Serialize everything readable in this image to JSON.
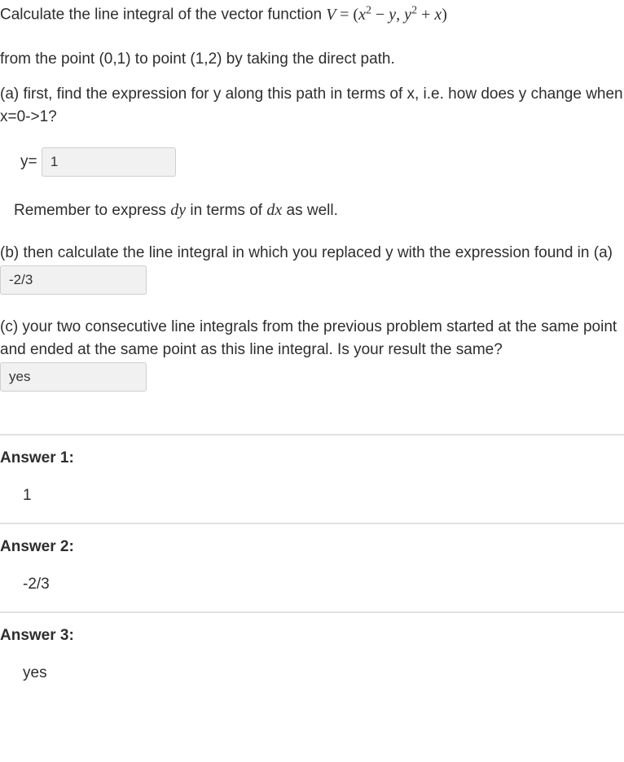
{
  "intro": {
    "line1_pre": "Calculate the line integral of the vector function ",
    "formula": "V = (x² − y, y² + x)",
    "line2": "from the point (0,1) to point (1,2) by taking the direct path."
  },
  "partA": {
    "text": "(a) first, find the expression  for y along this path in terms of x, i.e. how does y change when x=0->1?",
    "ylabel": "y=",
    "value": "1",
    "remember_pre": "Remember to express ",
    "dy": "dy",
    "remember_mid": " in terms of ",
    "dx": "dx",
    "remember_post": " as well."
  },
  "partB": {
    "text_pre": "(b) then calculate the line integral in which you replaced y with the expression found in (a)",
    "value": "-2/3"
  },
  "partC": {
    "text_pre": "(c) your two  consecutive line integrals from the previous problem started at the same point and ended at the same point as this line integral.  Is your result the same?",
    "value": "yes"
  },
  "answers": {
    "label1": "Answer 1:",
    "value1": "1",
    "label2": "Answer 2:",
    "value2": "-2/3",
    "label3": "Answer 3:",
    "value3": "yes"
  }
}
